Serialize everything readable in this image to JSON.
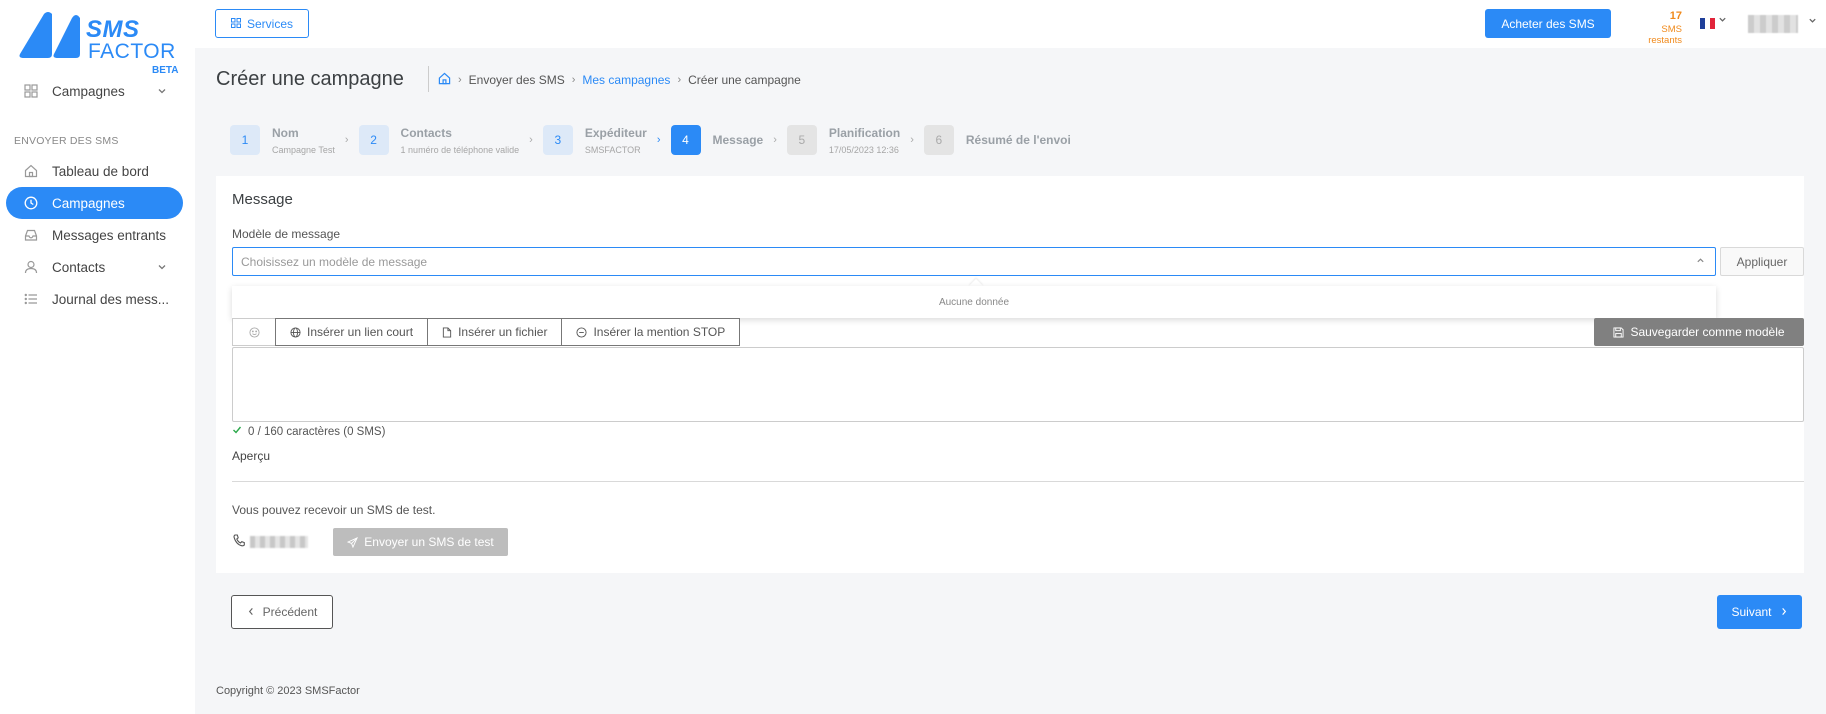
{
  "logo": {
    "line1": "SMS",
    "line2": "FACTOR",
    "line3": "BETA"
  },
  "sidebar": {
    "section_label": "ENVOYER DES SMS",
    "top_item": {
      "label": "Campagnes",
      "icon": "grid-icon"
    },
    "items": [
      {
        "label": "Tableau de bord",
        "icon": "home-icon"
      },
      {
        "label": "Campagnes",
        "icon": "clock-icon",
        "active": true
      },
      {
        "label": "Messages entrants",
        "icon": "inbox-icon"
      },
      {
        "label": "Contacts",
        "icon": "user-icon"
      },
      {
        "label": "Journal des mess...",
        "icon": "list-icon"
      }
    ]
  },
  "topbar": {
    "services_label": "Services",
    "buy_label": "Acheter des SMS",
    "credits_count": "17",
    "credits_label": "SMS restants"
  },
  "header": {
    "title": "Créer une campagne",
    "breadcrumb": [
      "Envoyer des SMS",
      "Mes campagnes",
      "Créer une campagne"
    ]
  },
  "steps": [
    {
      "num": "1",
      "label": "Nom",
      "sub": "Campagne Test",
      "state": "done"
    },
    {
      "num": "2",
      "label": "Contacts",
      "sub": "1 numéro de téléphone valide",
      "state": "done"
    },
    {
      "num": "3",
      "label": "Expéditeur",
      "sub": "SMSFACTOR",
      "state": "done"
    },
    {
      "num": "4",
      "label": "Message",
      "sub": "",
      "state": "current"
    },
    {
      "num": "5",
      "label": "Planification",
      "sub": "17/05/2023 12:36",
      "state": "todo"
    },
    {
      "num": "6",
      "label": "Résumé de l'envoi",
      "sub": "",
      "state": "todo"
    }
  ],
  "message_card": {
    "title": "Message",
    "template_label": "Modèle de message",
    "template_placeholder": "Choisissez un modèle de message",
    "apply_label": "Appliquer",
    "dropdown_empty": "Aucune donnée",
    "toolbar": {
      "short_link": "Insérer un lien court",
      "file": "Insérer un fichier",
      "stop": "Insérer la mention STOP",
      "save_template": "Sauvegarder comme modèle"
    },
    "char_count": "0 / 160 caractères (0 SMS)",
    "preview_label": "Aperçu",
    "test_text": "Vous pouvez recevoir un SMS de test.",
    "send_test_label": "Envoyer un SMS de test"
  },
  "footer_nav": {
    "prev_label": "Précédent",
    "next_label": "Suivant"
  },
  "copyright": "Copyright © 2023 SMSFactor",
  "colors": {
    "accent": "#2b8af6",
    "credits": "#f08a1c"
  }
}
